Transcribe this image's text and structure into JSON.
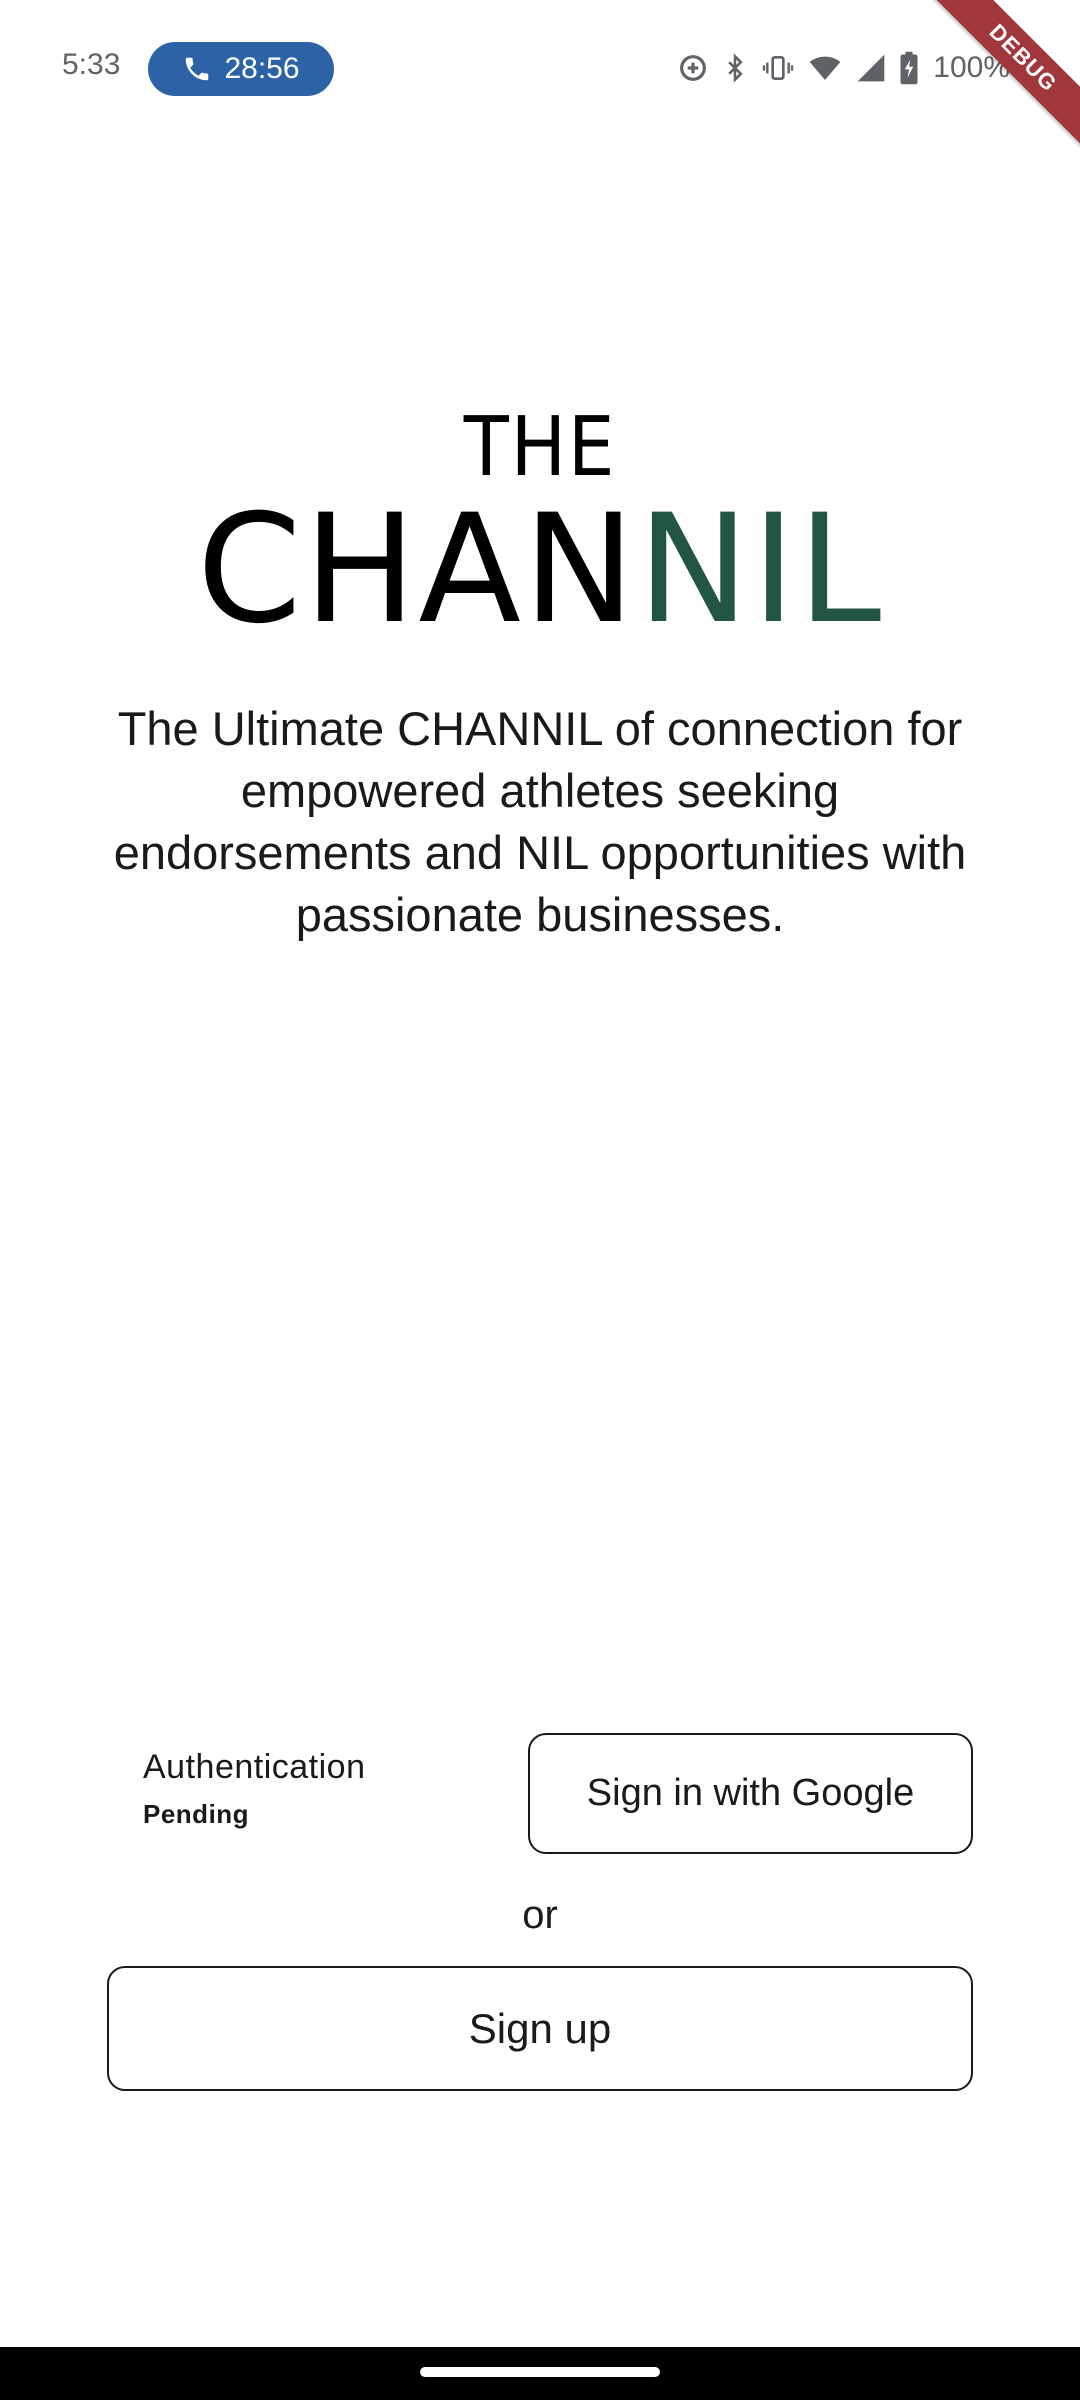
{
  "status_bar": {
    "time": "5:33",
    "call_timer": "28:56",
    "battery_percent": "100%",
    "icons": [
      "data-saver-icon",
      "bluetooth-icon",
      "vibrate-icon",
      "wifi-icon",
      "cellular-signal-icon",
      "battery-charging-icon"
    ]
  },
  "debug_banner": {
    "label": "DEBUG",
    "color": "#a1373b"
  },
  "logo": {
    "line1": "THE",
    "line2_black": "CHAN",
    "line2_green": "NIL",
    "accent_color": "#235543"
  },
  "tagline": "The Ultimate CHANNIL of connection for empowered athletes seeking endorsements and NIL opportunities with passionate businesses.",
  "auth": {
    "title": "Authentication",
    "status": "Pending",
    "google_button_label": "Sign in with Google",
    "or_label": "or",
    "signup_button_label": "Sign up"
  },
  "colors": {
    "call_chip": "#2b63a6",
    "text": "#1a1a1a"
  }
}
